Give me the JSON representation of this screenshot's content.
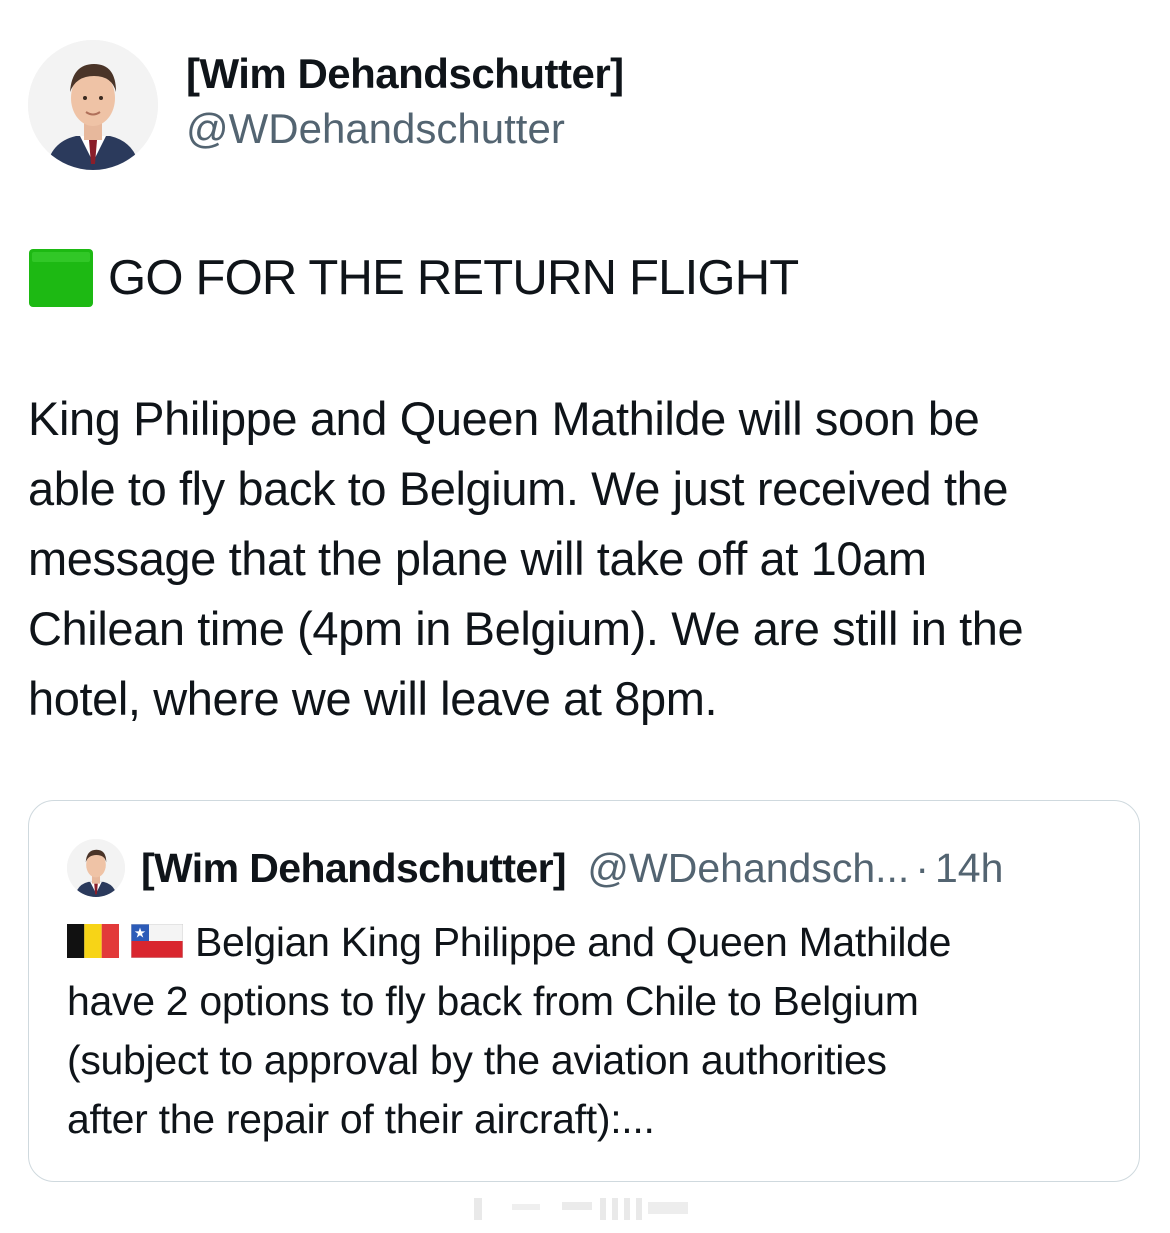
{
  "author": {
    "display_name": "[Wim Dehandschutter]",
    "handle": "@WDehandschutter",
    "avatar_icon": "profile-photo-icon"
  },
  "tweet": {
    "headline_icon": "green-square-emoji-icon",
    "headline": "GO FOR THE RETURN FLIGHT",
    "body_lines": [
      "King Philippe and Queen Mathilde will soon be",
      "able to fly back to Belgium. We just received the",
      "message that the plane will take off at 10am",
      "Chilean time (4pm in Belgium). We are still in the",
      "hotel, where we will leave at 8pm."
    ]
  },
  "quoted_tweet": {
    "display_name": "[Wim Dehandschutter]",
    "handle": "@WDehandsch...",
    "separator": "·",
    "time": "14h",
    "flags": [
      "belgium-flag-icon",
      "chile-flag-icon"
    ],
    "body_lines": [
      "Belgian King Philippe and Queen Mathilde",
      "have 2 options to fly back from Chile to Belgium",
      "(subject to approval by the aviation authorities",
      "after the repair of their aircraft):..."
    ]
  },
  "colors": {
    "text": "#0f1419",
    "secondary_text": "#536471",
    "border": "#cfd9de",
    "green_square": "#19b80f"
  }
}
